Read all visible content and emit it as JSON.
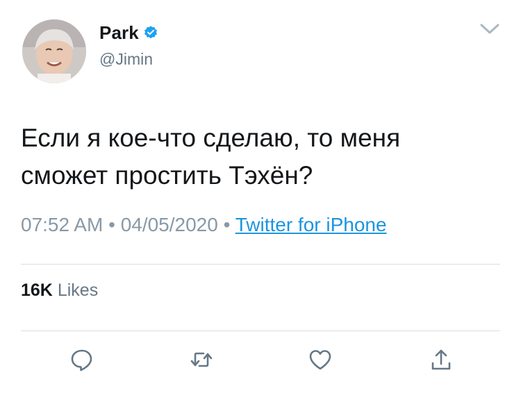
{
  "author": {
    "name": "Park",
    "handle": "@Jimin",
    "verified": true
  },
  "tweet": {
    "text": "Если я кое-что сделаю, то меня сможет простить Тэхён?",
    "time": "07:52 AM",
    "separator1": " • ",
    "date": "04/05/2020",
    "separator2": " • ",
    "source": "Twitter for iPhone"
  },
  "stats": {
    "likes_count": "16K",
    "likes_label": "Likes"
  },
  "icons": {
    "menu": "chevron-down-icon",
    "reply": "reply-icon",
    "retweet": "retweet-icon",
    "like": "heart-icon",
    "share": "share-icon",
    "verified": "verified-badge-icon"
  },
  "colors": {
    "text": "#14171a",
    "secondary": "#657786",
    "link": "#1b95e0",
    "verified": "#1da1f2",
    "icon": "#657786",
    "divider": "#d6dde3"
  }
}
